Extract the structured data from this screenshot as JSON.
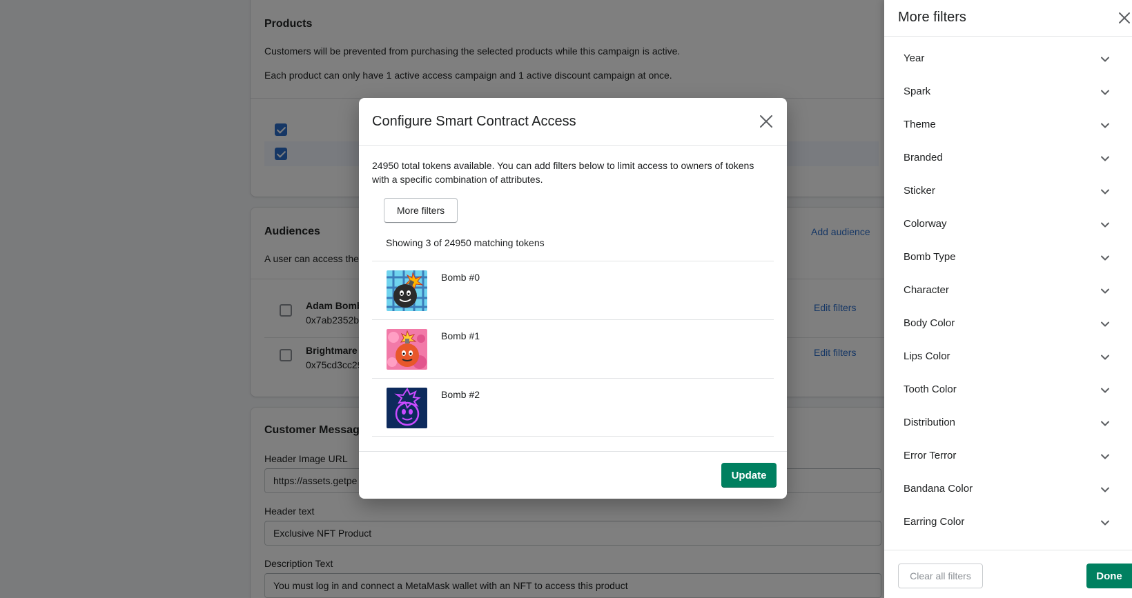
{
  "products": {
    "title": "Products",
    "text1": "Customers will be prevented from purchasing the selected products while this campaign is active.",
    "text2": "Each product can only have 1 active access campaign and 1 active discount campaign at once."
  },
  "audiences": {
    "title": "Audiences",
    "add_label": "Add audience",
    "description_visible": "A user can access the l",
    "items": [
      {
        "name": "Adam Bomb",
        "address": "0x7ab2352b",
        "edit_label": "Edit filters"
      },
      {
        "name": "Brightmare I",
        "address": "0x75cd3cc29",
        "edit_label": "Edit filters"
      }
    ]
  },
  "messaging": {
    "title": "Customer Messagin",
    "header_image_label": "Header Image URL",
    "header_image_value": "https://assets.getpe",
    "header_text_label": "Header text",
    "header_text_value": "Exclusive NFT Product",
    "description_label": "Description Text",
    "description_value": "You must log in and connect a MetaMask wallet with an NFT to access this product"
  },
  "modal": {
    "title": "Configure Smart Contract Access",
    "description": "24950 total tokens available. You can add filters below to limit access to owners of tokens with a specific combination of attributes.",
    "more_filters_label": "More filters",
    "showing_text": "Showing 3 of 24950 matching tokens",
    "tokens": [
      {
        "name": "Bomb #0"
      },
      {
        "name": "Bomb #1"
      },
      {
        "name": "Bomb #2"
      }
    ],
    "update_label": "Update"
  },
  "panel": {
    "title": "More filters",
    "filters": [
      "Year",
      "Spark",
      "Theme",
      "Branded",
      "Sticker",
      "Colorway",
      "Bomb Type",
      "Character",
      "Body Color",
      "Lips Color",
      "Tooth Color",
      "Distribution",
      "Error Terror",
      "Bandana Color",
      "Earring Color"
    ],
    "clear_label": "Clear all filters",
    "done_label": "Done"
  },
  "colors": {
    "primary_green": "#008060",
    "link_blue": "#2c6ecb",
    "overlay": "rgba(0,0,0,0.5)"
  }
}
